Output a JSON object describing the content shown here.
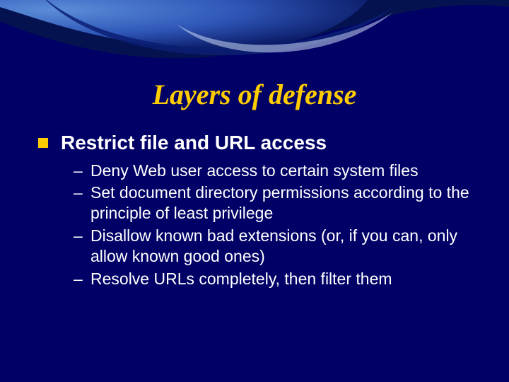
{
  "slide": {
    "title": "Layers of defense",
    "heading": "Restrict file and URL access",
    "bullets": {
      "b0": "Deny Web user access to certain system files",
      "b1": "Set document directory permissions according to the principle of least privilege",
      "b2": "Disallow known bad extensions (or, if you can, only allow known good ones)",
      "b3": "Resolve URLs completely, then filter them"
    },
    "dash": "–"
  }
}
